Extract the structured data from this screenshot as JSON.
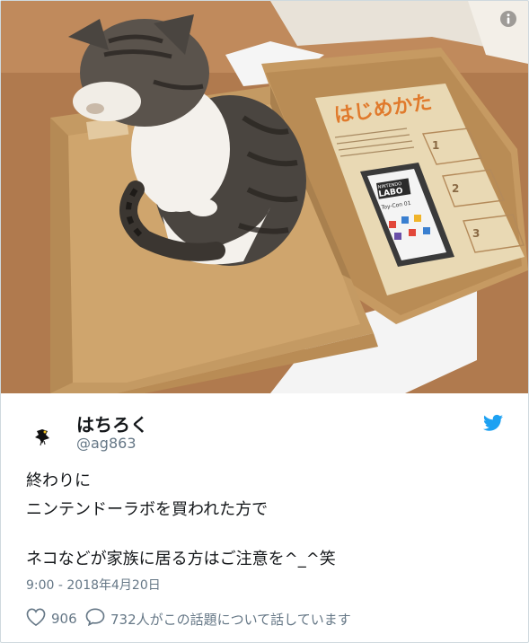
{
  "tweet": {
    "display_name": "はちろく",
    "handle": "@ag863",
    "lines": [
      "終わりに",
      "ニンテンドーラボを買われた方で",
      "",
      "ネコなどが家族に居る方はご注意を^_^笑"
    ],
    "timestamp": "9:00 - 2018年4月20日",
    "like_count": "906",
    "reply_text": "732人がこの話題について話しています"
  },
  "photo": {
    "manual_title": "はじめかた",
    "product_logo_top": "NINTENDO",
    "product_logo_main": "LABO",
    "product_subtitle": "Toy-Con 01",
    "manual_steps": [
      "1",
      "2",
      "3"
    ]
  },
  "colors": {
    "twitter_blue": "#1da1f2",
    "text_primary": "#14171a",
    "text_secondary": "#657786",
    "cardboard": "#c8a06e",
    "floor": "#b07a4e"
  },
  "icons": {
    "info": "info-icon",
    "twitter": "twitter-bird-icon",
    "like": "heart-icon",
    "reply": "speech-bubble-icon"
  }
}
